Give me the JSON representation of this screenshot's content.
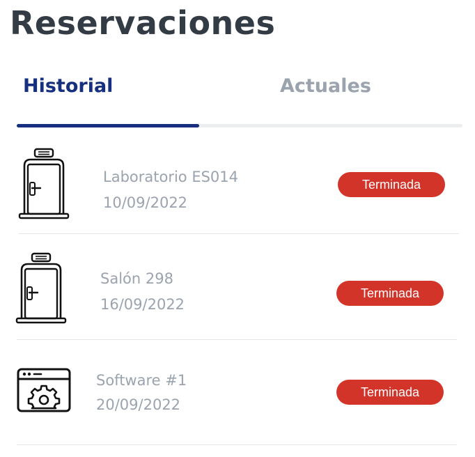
{
  "page": {
    "title": "Reservaciones"
  },
  "tabs": [
    {
      "label": "Historial",
      "active": true
    },
    {
      "label": "Actuales",
      "active": false
    }
  ],
  "colors": {
    "accent": "#16307f",
    "badge": "#d3342a",
    "muted": "#9aa3ae",
    "title": "#333b45"
  },
  "reservations": [
    {
      "icon": "door-icon",
      "name": "Laboratorio ES014",
      "date": "10/09/2022",
      "status": "Terminada"
    },
    {
      "icon": "door-icon",
      "name": "Salón 298",
      "date": "16/09/2022",
      "status": "Terminada"
    },
    {
      "icon": "software-settings-icon",
      "name": "Software #1",
      "date": "20/09/2022",
      "status": "Terminada"
    }
  ]
}
